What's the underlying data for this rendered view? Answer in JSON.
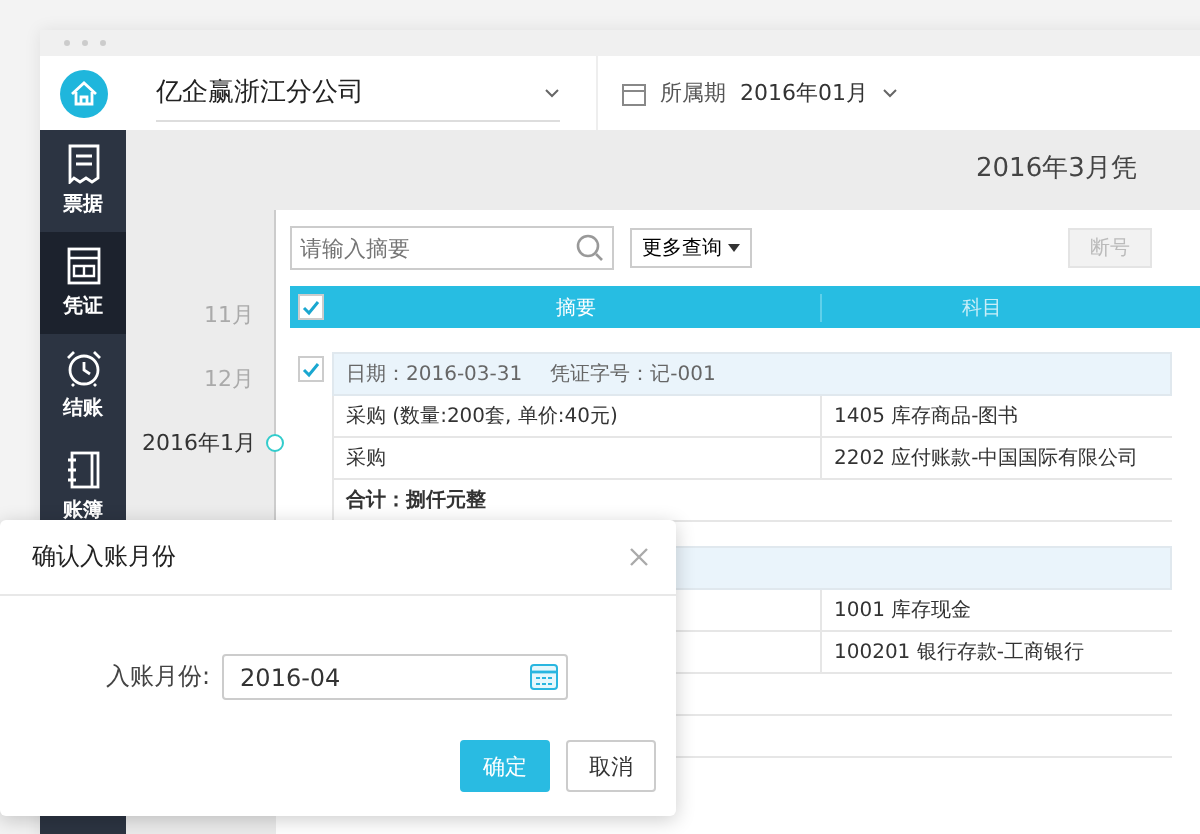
{
  "app": {
    "company": "亿企赢浙江分公司",
    "period_label": "所属期",
    "period_value": "2016年01月"
  },
  "sidebar": {
    "items": [
      {
        "label": "票据",
        "selected": false
      },
      {
        "label": "凭证",
        "selected": true
      },
      {
        "label": "结账",
        "selected": false
      },
      {
        "label": "账簿",
        "selected": false
      }
    ]
  },
  "page_title": "2016年3月凭",
  "timeline": [
    {
      "label": "11月",
      "selected": false
    },
    {
      "label": "12月",
      "selected": false
    },
    {
      "label": "2016年1月",
      "selected": true
    }
  ],
  "toolbar": {
    "search": {
      "placeholder": "请输入摘要"
    },
    "more_button": "更多查询",
    "right_button": "断号"
  },
  "table": {
    "select_all": true,
    "columns": [
      "摘要",
      "科目"
    ],
    "vouchers": [
      {
        "checked": true,
        "date_label": "日期：2016-03-31",
        "number_label": "凭证字号：记-001",
        "rows": [
          {
            "summary": "采购 (数量:200套, 单价:40元)",
            "account": "1405 库存商品-图书"
          },
          {
            "summary": "采购",
            "account": "2202 应付账款-中国国际有限公司"
          }
        ],
        "total": "合计：捌仟元整"
      },
      {
        "rows": [
          {
            "account": "1001 库存现金"
          },
          {
            "account": "100201 银行存款-工商银行"
          }
        ]
      }
    ]
  },
  "dialog": {
    "title": "确认入账月份",
    "field_label": "入账月份:",
    "field_value": "2016-04",
    "buttons": [
      {
        "label": "确定",
        "kind": "primary"
      },
      {
        "label": "取消",
        "kind": "default"
      }
    ]
  }
}
